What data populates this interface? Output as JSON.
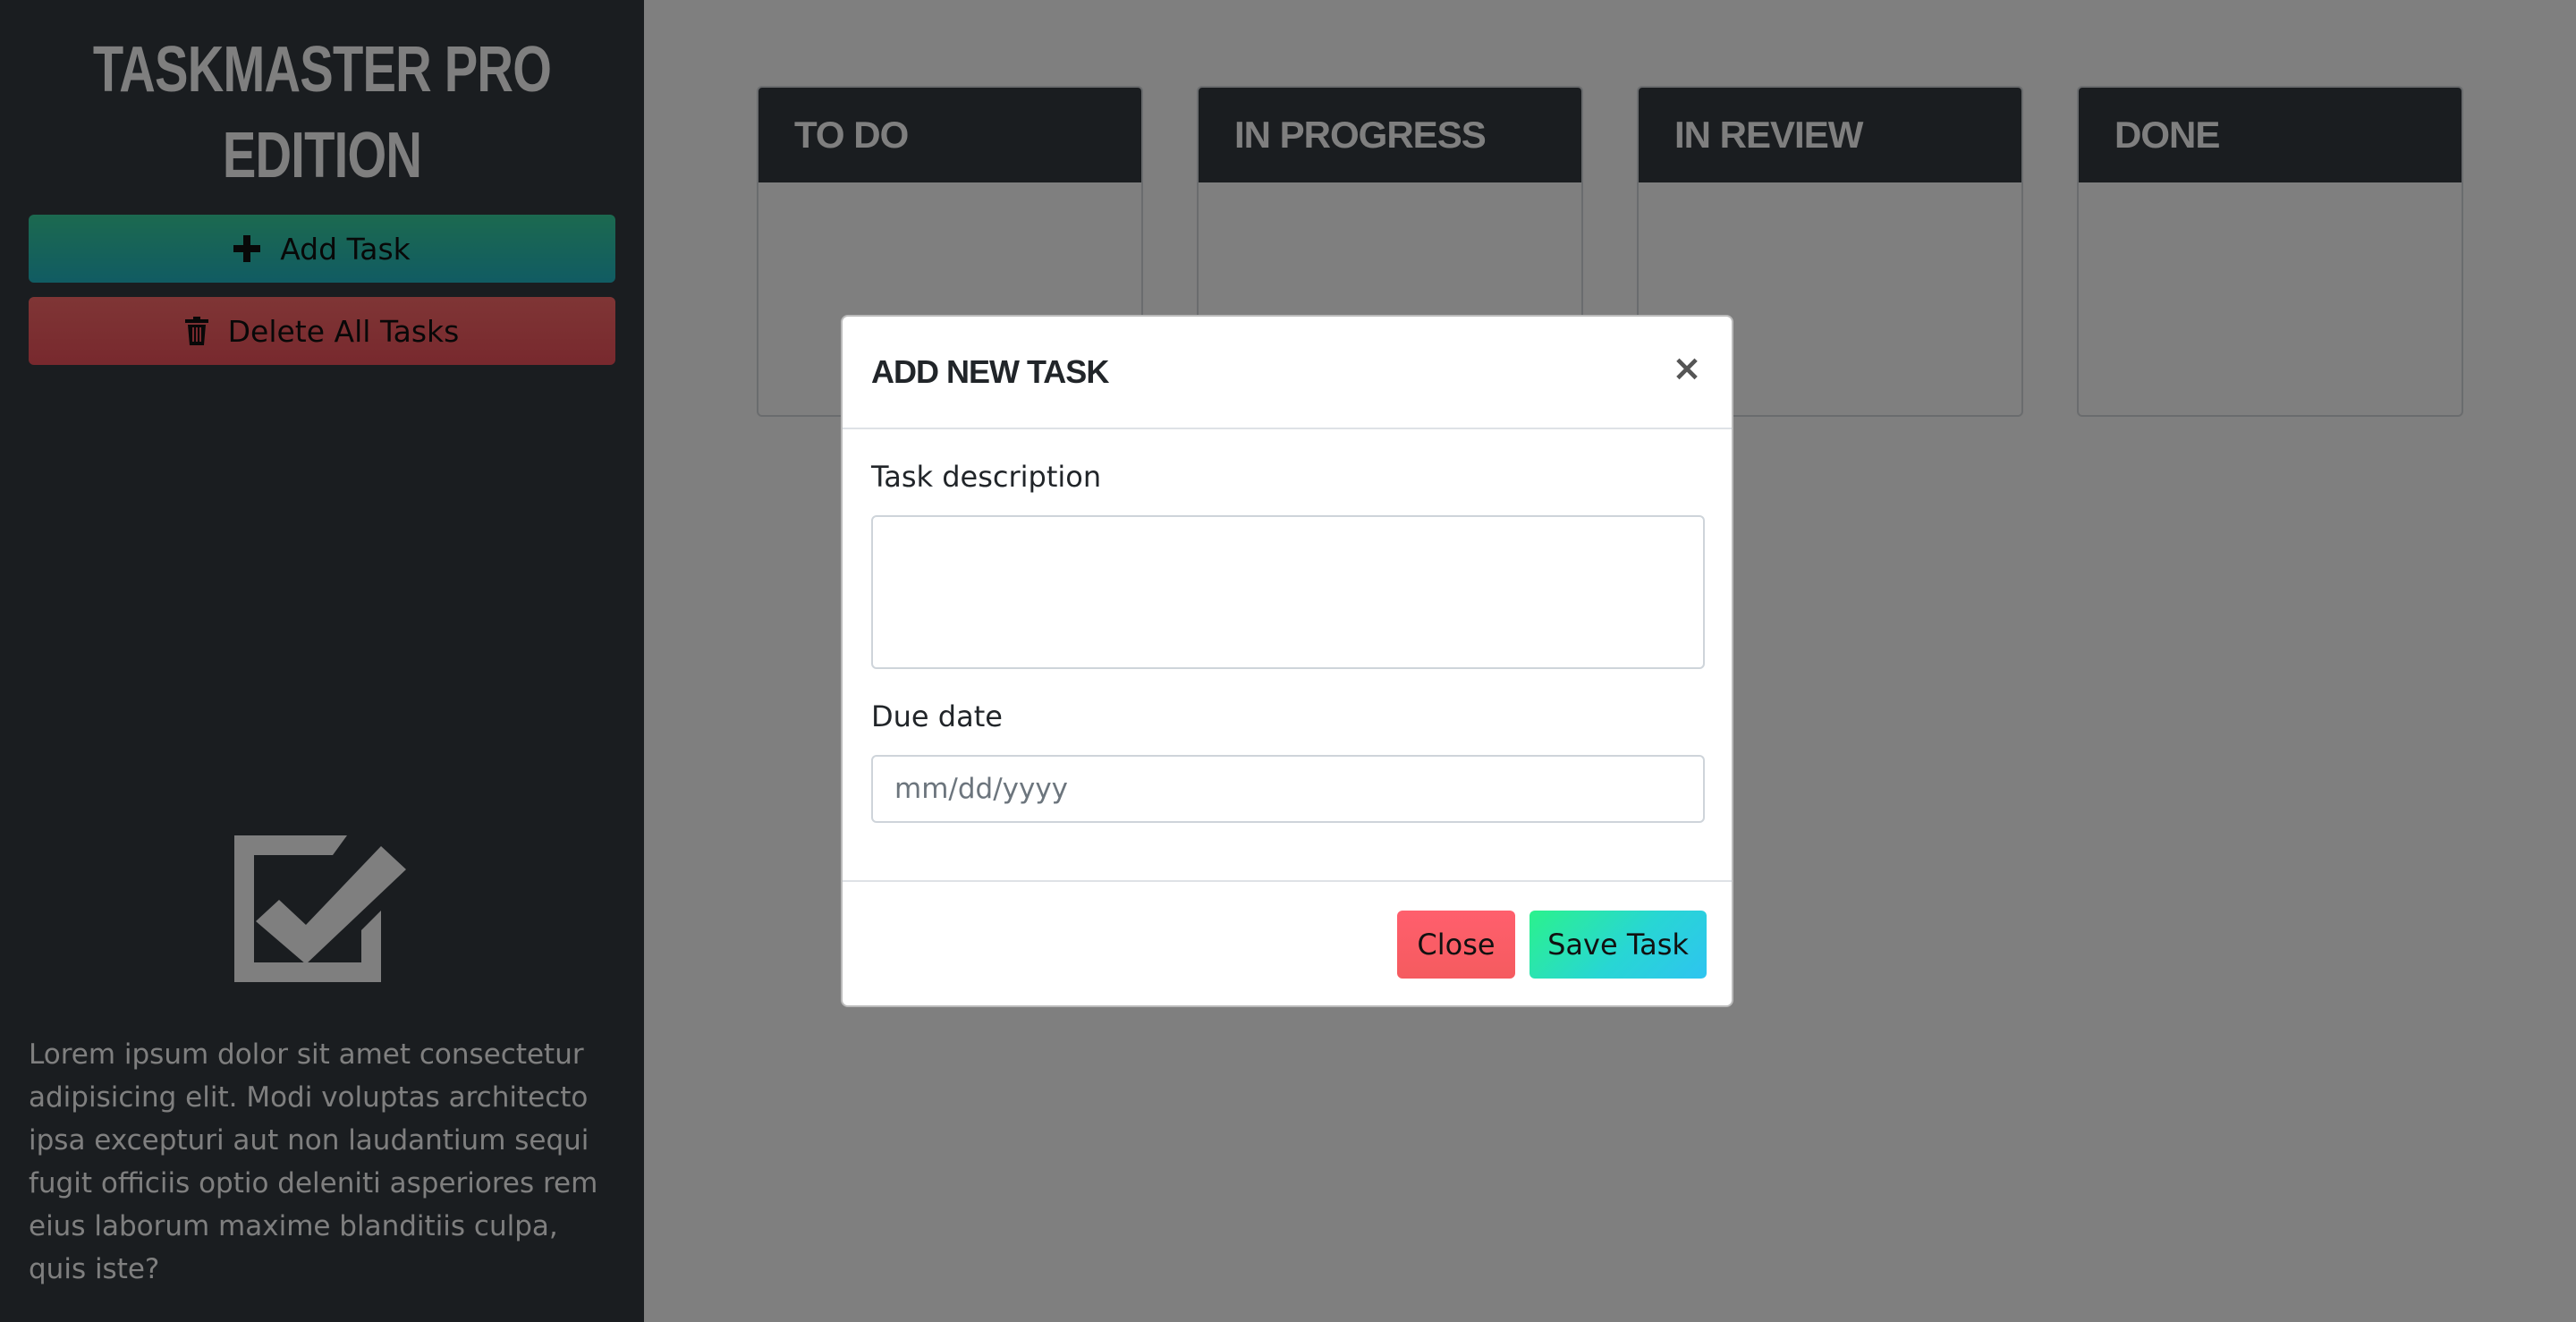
{
  "sidebar": {
    "title": "TASKMASTER PRO EDITION",
    "add_task_label": "Add Task",
    "delete_all_label": "Delete All Tasks",
    "description": "Lorem ipsum dolor sit amet consectetur adipisicing elit. Modi voluptas architecto ipsa excepturi aut non laudantium sequi fugit officiis optio deleniti asperiores rem eius laborum maxime blanditiis culpa, quis iste?",
    "icons": {
      "add": "plus-icon",
      "delete": "trash-icon",
      "logo": "checkbox-check-icon"
    }
  },
  "board": {
    "columns": [
      {
        "title": "TO DO"
      },
      {
        "title": "IN PROGRESS"
      },
      {
        "title": "IN REVIEW"
      },
      {
        "title": "DONE"
      }
    ]
  },
  "modal": {
    "title": "ADD NEW TASK",
    "close_glyph": "×",
    "description_label": "Task description",
    "description_value": "",
    "due_date_label": "Due date",
    "due_date_placeholder": "mm/dd/yyyy",
    "close_button": "Close",
    "save_button": "Save Task"
  },
  "colors": {
    "sidebar_bg": "#343a40",
    "add_gradient": [
      "#38d39f",
      "#22b8c6"
    ],
    "delete_gradient": [
      "#ff6b6b",
      "#f0525c"
    ],
    "save_gradient": [
      "#2bf28c",
      "#2ec4f0"
    ],
    "close_color": "#ff5f6d",
    "backdrop": "rgba(0,0,0,0.5)"
  }
}
